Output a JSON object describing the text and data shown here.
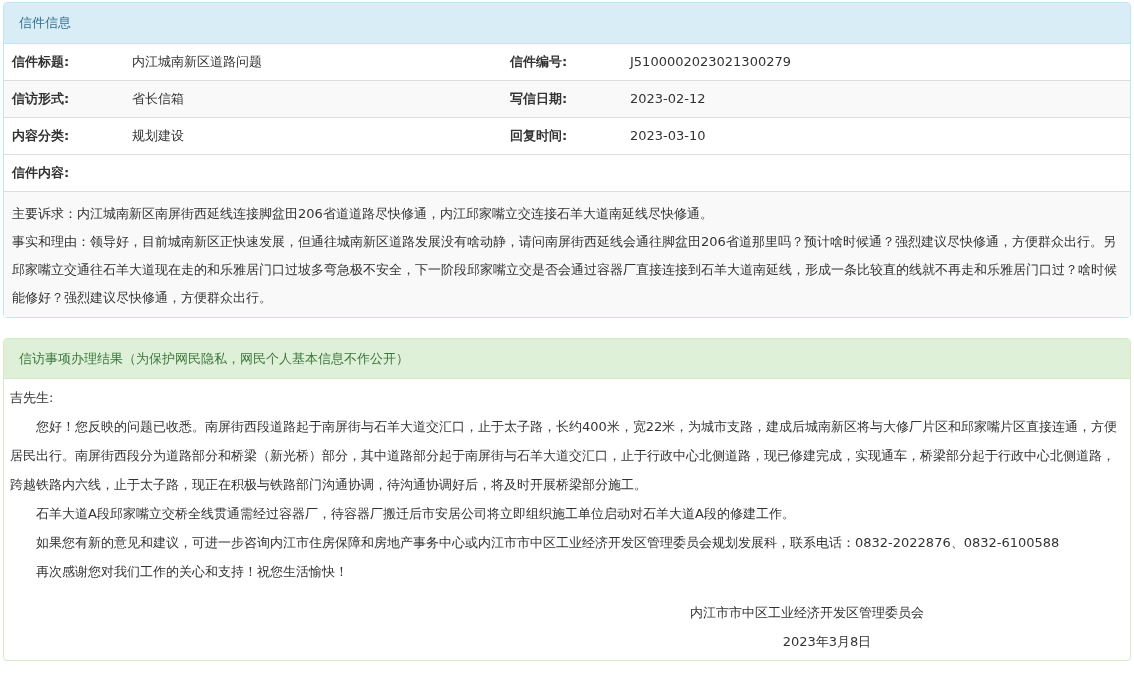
{
  "letter_panel": {
    "title": "信件信息",
    "fields": [
      {
        "label": "信件标题:",
        "value": "内江城南新区道路问题",
        "label_2": "信件编号:",
        "value_2": "J5100002023021300279"
      },
      {
        "label": "信访形式:",
        "value": "省长信箱",
        "label_2": "写信日期:",
        "value_2": "2023-02-12"
      },
      {
        "label": "内容分类:",
        "value": "规划建设",
        "label_2": "回复时间:",
        "value_2": "2023-03-10"
      }
    ],
    "content_label": "信件内容:",
    "content": [
      "主要诉求：内江城南新区南屏街西延线连接脚盆田206省道道路尽快修通，内江邱家嘴立交连接石羊大道南延线尽快修通。",
      "事实和理由：领导好，目前城南新区正快速发展，但通往城南新区道路发展没有啥动静，请问南屏街西延线会通往脚盆田206省道那里吗？预计啥时候通？强烈建议尽快修通，方便群众出行。另邱家嘴立交通往石羊大道现在走的和乐雅居门口过坡多弯急极不安全，下一阶段邱家嘴立交是否会通过容器厂直接连接到石羊大道南延线，形成一条比较直的线就不再走和乐雅居门口过？啥时候能修好？强烈建议尽快修通，方便群众出行。"
    ]
  },
  "reply_panel": {
    "title": "信访事项办理结果（为保护网民隐私，网民个人基本信息不作公开）",
    "greeting": "吉先生:",
    "paragraphs": [
      "您好！您反映的问题已收悉。南屏街西段道路起于南屏街与石羊大道交汇口，止于太子路，长约400米，宽22米，为城市支路，建成后城南新区将与大修厂片区和邱家嘴片区直接连通，方便居民出行。南屏街西段分为道路部分和桥梁（新光桥）部分，其中道路部分起于南屏街与石羊大道交汇口，止于行政中心北侧道路，现已修建完成，实现通车，桥梁部分起于行政中心北侧道路，跨越铁路内六线，止于太子路，现正在积极与铁路部门沟通协调，待沟通协调好后，将及时开展桥梁部分施工。",
      "石羊大道A段邱家嘴立交桥全线贯通需经过容器厂，待容器厂搬迁后市安居公司将立即组织施工单位启动对石羊大道A段的修建工作。",
      "如果您有新的意见和建议，可进一步咨询内江市住房保障和房地产事务中心或内江市市中区工业经济开发区管理委员会规划发展科，联系电话：0832-2022876、0832-6100588",
      "再次感谢您对我们工作的关心和支持！祝您生活愉快！"
    ],
    "signature": "内江市市中区工业经济开发区管理委员会",
    "date": "2023年3月8日"
  }
}
